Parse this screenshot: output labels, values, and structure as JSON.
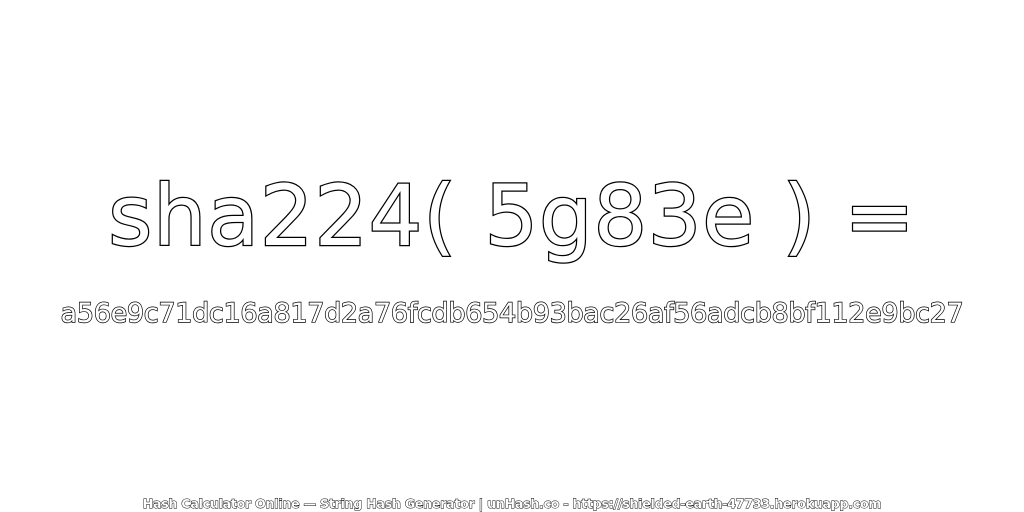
{
  "headline": "sha224( 5g83e ) =",
  "hash_value": "a56e9c71dc16a817d2a76fcdb654b93bac26af56adcb8bf112e9bc27",
  "footer": "Hash Calculator Online — String Hash Generator | unHash.co - https://shielded-earth-47733.herokuapp.com",
  "colors": {
    "background": "#ffffff",
    "text_fill": "#ffffff",
    "text_outline": "#000000"
  }
}
